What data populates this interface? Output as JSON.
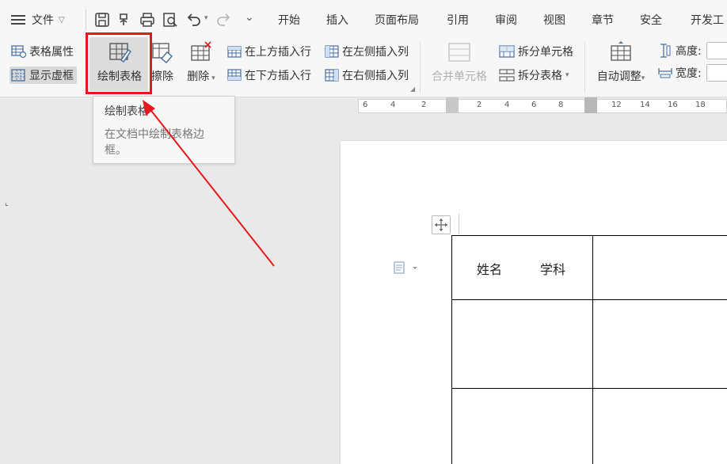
{
  "menubar": {
    "file_label": "文件",
    "tabs": [
      "开始",
      "插入",
      "页面布局",
      "引用",
      "审阅",
      "视图",
      "章节",
      "安全",
      "开发工"
    ]
  },
  "ribbon": {
    "table_properties": "表格属性",
    "show_virtual_border": "显示虚框",
    "draw_table": "绘制表格",
    "erase": "擦除",
    "delete": "删除",
    "insert_row_above": "在上方插入行",
    "insert_row_below": "在下方插入行",
    "insert_col_left": "在左侧插入列",
    "insert_col_right": "在右侧插入列",
    "merge_cells": "合并单元格",
    "split_cells": "拆分单元格",
    "split_table": "拆分表格",
    "auto_adjust": "自动调整",
    "height_label": "高度:",
    "width_label": "宽度:"
  },
  "tooltip": {
    "title": "绘制表格",
    "body": "在文档中绘制表格边框。"
  },
  "ruler": {
    "ticks": [
      "6",
      "4",
      "2",
      "2",
      "4",
      "6",
      "8",
      "12",
      "14",
      "16",
      "18"
    ]
  },
  "table": {
    "cell_name": "姓名",
    "cell_subject": "学科"
  },
  "colors": {
    "highlight": "#e5191c",
    "arrow": "#e5191c"
  }
}
